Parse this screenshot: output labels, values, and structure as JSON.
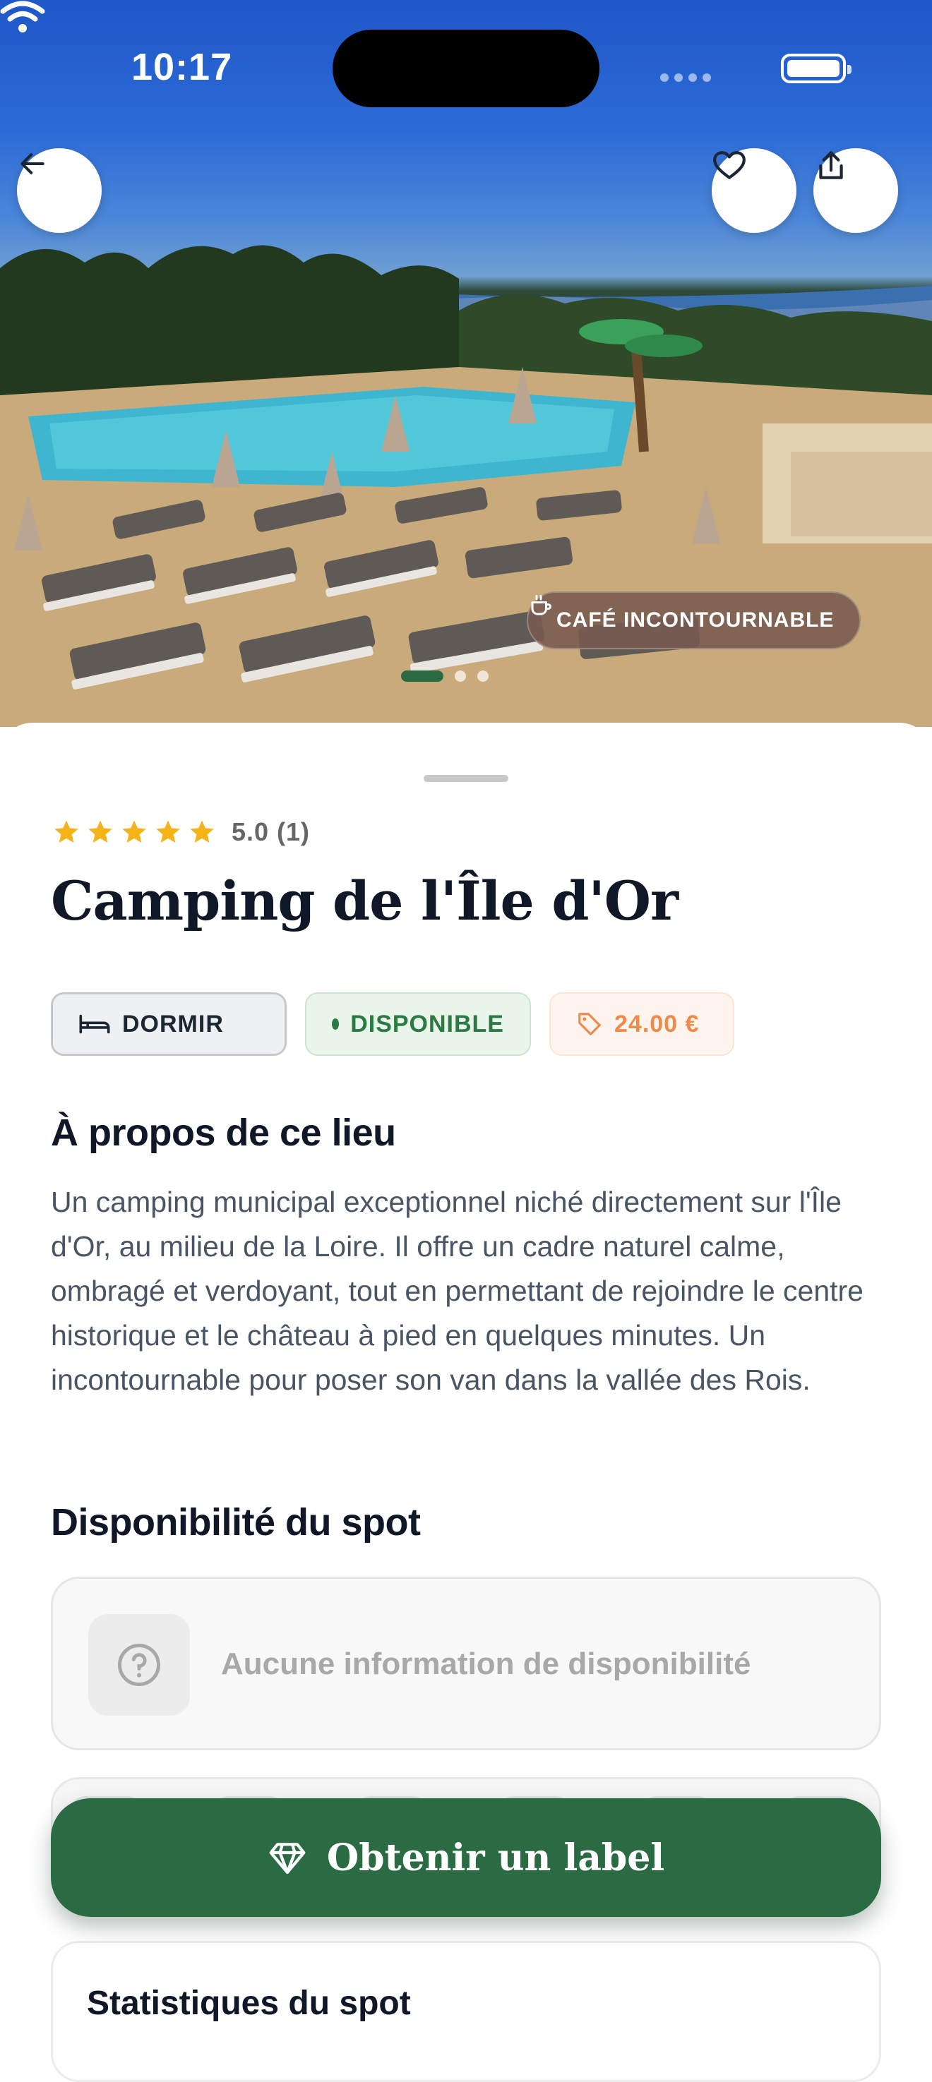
{
  "status_bar": {
    "time": "10:17"
  },
  "hero": {
    "badge_label": "CAFÉ INCONTOURNABLE",
    "carousel_count": 3,
    "carousel_active": 1
  },
  "place": {
    "rating": "5.0 (1)",
    "stars": 5,
    "title": "Camping de l'Île d'Or",
    "category": "DORMIR",
    "status": "DISPONIBLE",
    "price": "24.00 €"
  },
  "about": {
    "title": "À propos de ce lieu",
    "description": "Un camping municipal exceptionnel niché directement sur l'Île d'Or, au milieu de la Loire. Il offre un cadre naturel calme, ombragé et verdoyant, tout en permettant de rejoindre le centre historique et le château à pied en quelques minutes. Un incontournable pour poser son van dans la vallée des Rois."
  },
  "availability": {
    "title": "Disponibilité du spot",
    "empty_text": "Aucune information de disponibilité"
  },
  "stats": {
    "title": "Statistiques du spot"
  },
  "cta": {
    "label": "Obtenir un label"
  },
  "colors": {
    "primary_green": "#2a6b43",
    "star": "#f6b21a",
    "price_orange": "#ee8a4a"
  }
}
